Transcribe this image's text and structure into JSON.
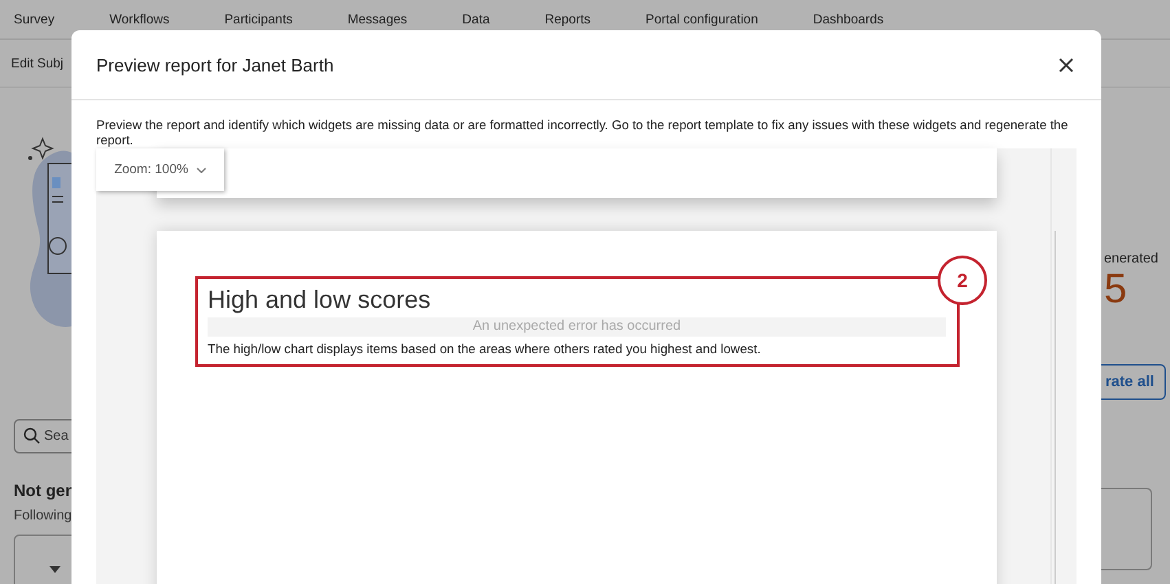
{
  "nav": {
    "tabs": [
      {
        "label": "Survey"
      },
      {
        "label": "Workflows"
      },
      {
        "label": "Participants"
      },
      {
        "label": "Messages"
      },
      {
        "label": "Data"
      },
      {
        "label": "Reports"
      },
      {
        "label": "Portal configuration"
      },
      {
        "label": "Dashboards"
      }
    ]
  },
  "subnav": {
    "label": "Edit Subj"
  },
  "left_panel": {
    "search": {
      "placeholder": "Sea"
    },
    "heading": "Not gen",
    "subtext": "Following"
  },
  "right_panel": {
    "label": "enerated",
    "count": "5",
    "button": "rate all"
  },
  "modal": {
    "title": "Preview report for Janet Barth",
    "description": "Preview the report and identify which widgets are missing data or are formatted incorrectly. Go to the report template to fix any issues with these widgets and regenerate the report.",
    "zoom": "Zoom: 100%",
    "widget": {
      "title": "High and low scores",
      "error": "An unexpected error has occurred",
      "description": "The high/low chart displays items based on the areas where others rated you highest and lowest.",
      "badge": "2"
    }
  }
}
